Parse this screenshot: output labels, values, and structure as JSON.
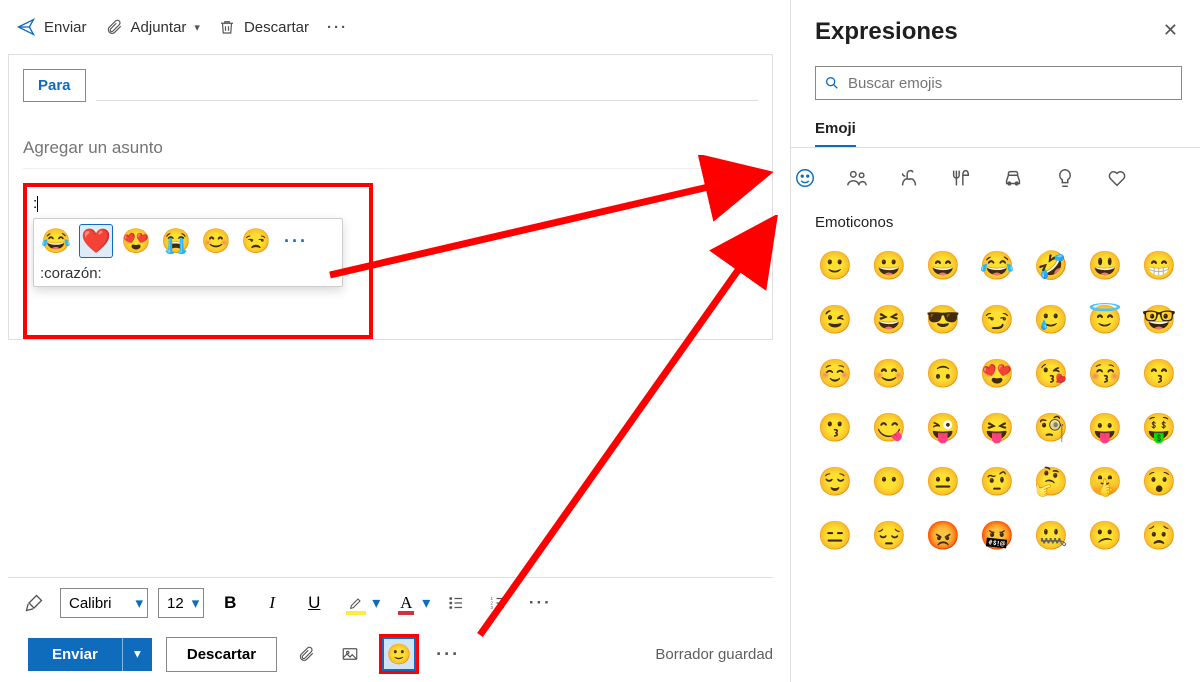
{
  "cmdbar": {
    "send": "Enviar",
    "attach": "Adjuntar",
    "discard": "Descartar"
  },
  "compose": {
    "to_label": "Para",
    "subject_placeholder": "Agregar un asunto",
    "typed": ":",
    "suggestion_label": ":corazón:",
    "suggestions": [
      "😂",
      "❤️",
      "😍",
      "😭",
      "😊",
      "😒"
    ]
  },
  "format": {
    "font": "Calibri",
    "size": "12"
  },
  "sendbar": {
    "send": "Enviar",
    "discard": "Descartar",
    "status": "Borrador guardad"
  },
  "panel": {
    "title": "Expresiones",
    "search_placeholder": "Buscar emojis",
    "tab": "Emoji",
    "section": "Emoticonos",
    "emojis": [
      "🙂",
      "😀",
      "😄",
      "😂",
      "🤣",
      "😃",
      "😁",
      "😉",
      "😆",
      "😎",
      "😏",
      "🥲",
      "😇",
      "🤓",
      "☺️",
      "😊",
      "🙃",
      "😍",
      "😘",
      "😚",
      "😙",
      "😗",
      "😋",
      "😜",
      "😝",
      "🧐",
      "😛",
      "🤑",
      "😌",
      "😶",
      "😐",
      "🤨",
      "🤔",
      "🤫",
      "😯",
      "😑",
      "😔",
      "😡",
      "🤬",
      "🤐",
      "😕",
      "😟"
    ]
  }
}
